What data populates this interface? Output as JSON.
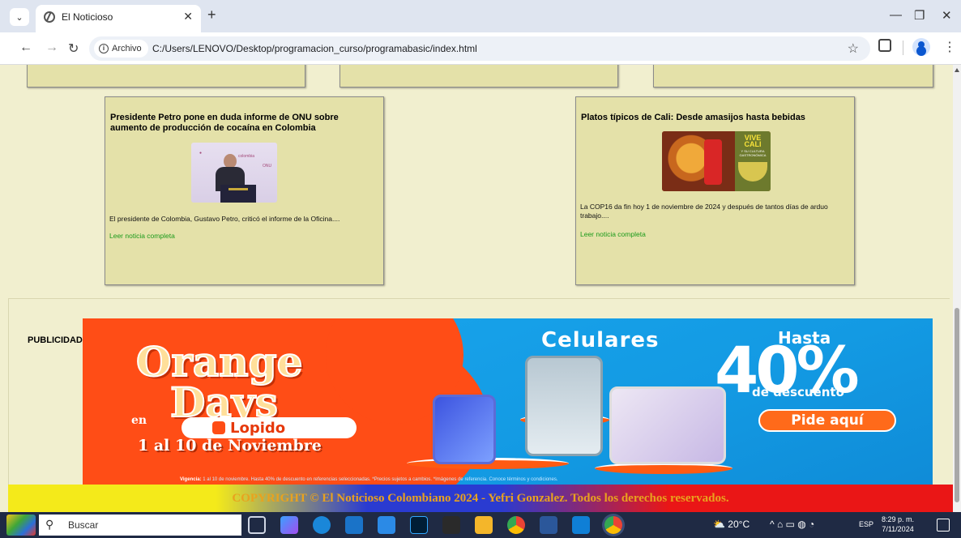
{
  "browser": {
    "tab_title": "El Noticioso",
    "info_chip": "Archivo",
    "url": "C:/Users/LENOVO/Desktop/programacion_curso/programabasic/index.html",
    "icons": [
      "tab-search-icon",
      "favicon-icon",
      "close-icon",
      "plus-icon",
      "minimize-icon",
      "restore-icon",
      "window-close-icon",
      "back-icon",
      "forward-icon",
      "reload-icon",
      "info-icon",
      "star-icon",
      "extensions-icon",
      "profile-icon",
      "menu-icon"
    ]
  },
  "news": [
    {
      "title": "Presidente Petro pone en duda informe de ONU sobre aumento de producción de cocaína en Colombia",
      "excerpt": "El presidente de Colombia, Gustavo Petro, criticó el informe de la Oficina....",
      "link": "Leer noticia completa"
    },
    {
      "title": "Platos típicos de Cali: Desde amasijos hasta bebidas",
      "excerpt": "La COP16 da fin hoy 1 de noviembre de 2024 y después de tantos días de arduo trabajo....",
      "link": "Leer noticia completa",
      "image_text": {
        "vive": "VIVE",
        "cali": "CALI",
        "sub": "Y SU CULTURA GASTRONÓMICA"
      }
    }
  ],
  "publicidad": {
    "label": "PUBLICIDAD",
    "banner": {
      "line1": "Orange",
      "line2": "Days",
      "en": "en",
      "brand": "Lopido",
      "dates": "1 al 10 de Noviembre",
      "celulares": "Celulares",
      "hasta": "Hasta",
      "percent": "40%",
      "descuento": "de descuento",
      "cta": "Pide aquí",
      "fine_label": "Vigencia:",
      "fine_text": "1 al 10 de noviembre. Hasta 40% de descuento en referencias seleccionadas. *Precios sujetos a cambios. *Imágenes de referencia. Conoce términos y condiciones."
    },
    "colors": {
      "orange": "#ff4d16",
      "blue": "#139ae3"
    }
  },
  "footer": {
    "text": "COPYRIGHT © El Noticioso Colombiano 2024 - Yefri Gonzalez. Todos los derechos reservados."
  },
  "taskbar": {
    "search": "Buscar",
    "weather": "20°C",
    "language": "ESP",
    "time": "8:29 p. m.",
    "date": "7/11/2024"
  },
  "colors": {
    "page_bg": "#f1efcf",
    "card_bg": "#e4e1a9",
    "link": "#1a9a1a",
    "footer_text": "#e9a21e"
  }
}
